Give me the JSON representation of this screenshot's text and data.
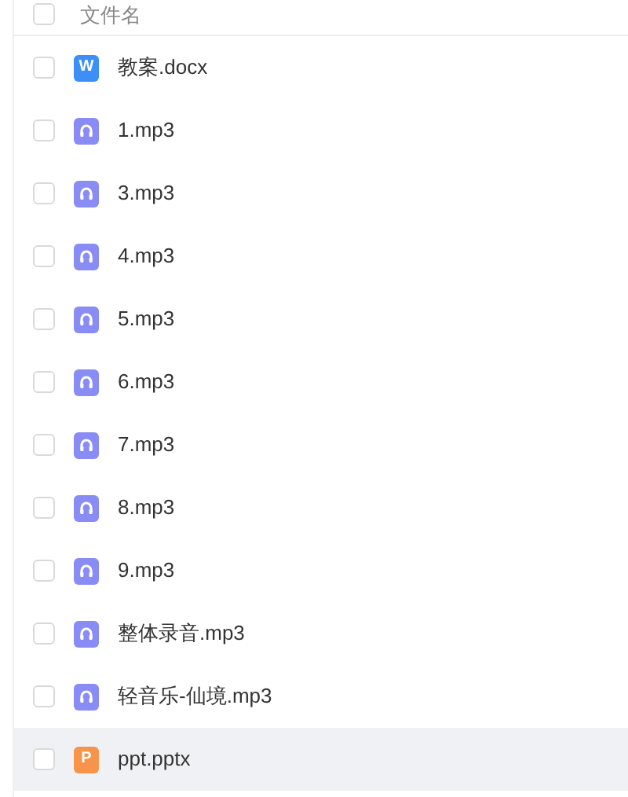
{
  "header": {
    "column": "文件名",
    "checked": false
  },
  "files": [
    {
      "name": "教案.docx",
      "kind": "doc",
      "badge": "W",
      "checked": false,
      "highlighted": false
    },
    {
      "name": "1.mp3",
      "kind": "audio",
      "checked": false,
      "highlighted": false
    },
    {
      "name": "3.mp3",
      "kind": "audio",
      "checked": false,
      "highlighted": false
    },
    {
      "name": "4.mp3",
      "kind": "audio",
      "checked": false,
      "highlighted": false
    },
    {
      "name": "5.mp3",
      "kind": "audio",
      "checked": false,
      "highlighted": false
    },
    {
      "name": "6.mp3",
      "kind": "audio",
      "checked": false,
      "highlighted": false
    },
    {
      "name": "7.mp3",
      "kind": "audio",
      "checked": false,
      "highlighted": false
    },
    {
      "name": "8.mp3",
      "kind": "audio",
      "checked": false,
      "highlighted": false
    },
    {
      "name": "9.mp3",
      "kind": "audio",
      "checked": false,
      "highlighted": false
    },
    {
      "name": "整体录音.mp3",
      "kind": "audio",
      "checked": false,
      "highlighted": false
    },
    {
      "name": "轻音乐-仙境.mp3",
      "kind": "audio",
      "checked": false,
      "highlighted": false
    },
    {
      "name": "ppt.pptx",
      "kind": "slides",
      "badge": "P",
      "checked": false,
      "highlighted": true
    }
  ]
}
